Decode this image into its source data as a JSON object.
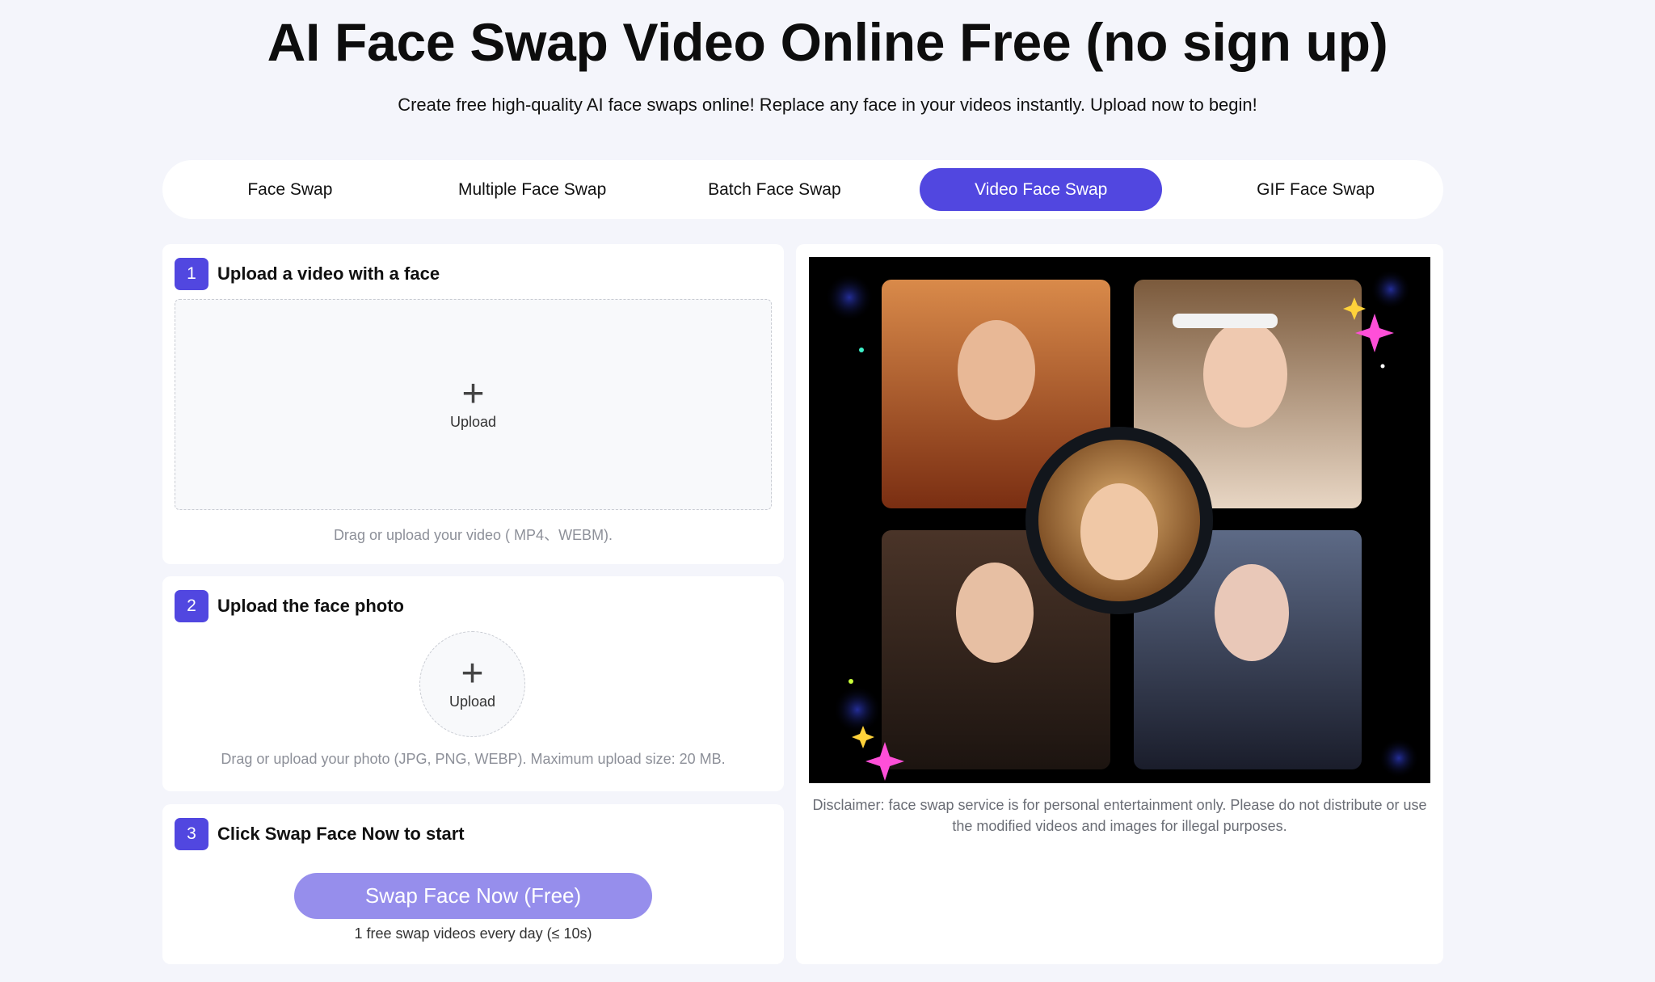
{
  "header": {
    "title": "AI Face Swap Video Online Free (no sign up)",
    "subtitle": "Create free high-quality AI face swaps online! Replace any face in your videos instantly. Upload now to begin!"
  },
  "tabs": [
    {
      "label": "Face Swap"
    },
    {
      "label": "Multiple Face Swap"
    },
    {
      "label": "Batch Face Swap"
    },
    {
      "label": "Video Face Swap",
      "active": true
    },
    {
      "label": "GIF Face Swap"
    }
  ],
  "step1": {
    "number": "1",
    "title": "Upload a video with a face",
    "upload_label": "Upload",
    "hint": "Drag or upload your video ( MP4、WEBM)."
  },
  "step2": {
    "number": "2",
    "title": "Upload the face photo",
    "upload_label": "Upload",
    "hint": "Drag or upload your photo (JPG, PNG, WEBP). Maximum upload size: 20 MB."
  },
  "step3": {
    "number": "3",
    "title": "Click Swap Face Now to start",
    "button_label": "Swap Face Now (Free)",
    "note": "1 free swap videos every day (≤ 10s)"
  },
  "preview": {
    "disclaimer": "Disclaimer: face swap service is for personal entertainment only. Please do not distribute or use the modified videos and images for illegal purposes."
  },
  "colors": {
    "accent": "#5147e0",
    "button_disabled": "#968eec",
    "page_bg": "#f4f5fb"
  }
}
